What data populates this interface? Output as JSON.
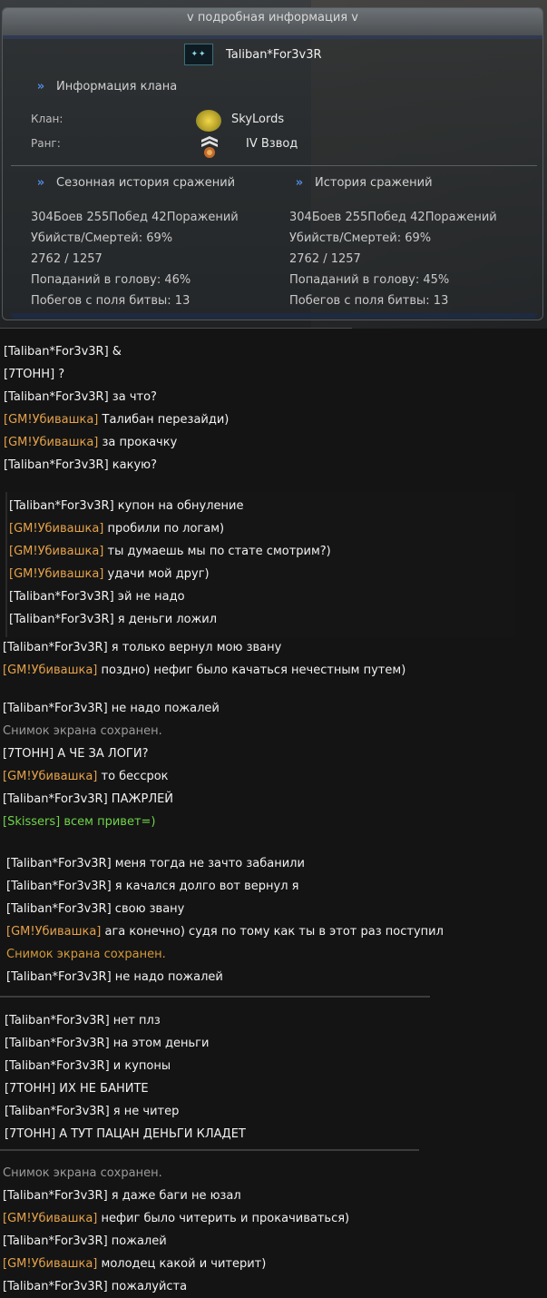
{
  "panel": {
    "title": "v подробная информация v",
    "player_name": "Taliban*For3v3R",
    "player_icon_text": "✦✦",
    "clan_section": "Информация клана",
    "clan_label": "Клан:",
    "clan_value": "SkyLords",
    "rank_label": "Ранг:",
    "rank_value": "IV Взвод",
    "season_section": "Сезонная история сражений",
    "history_section": "История сражений",
    "season_stats": [
      "304Боев 255Побед 42Поражений",
      "Убийств/Смертей: 69%",
      "2762 / 1257",
      "Попаданий в голову: 46%",
      "Побегов с поля битвы: 13"
    ],
    "history_stats": [
      "304Боев 255Побед 42Поражений",
      "Убийств/Смертей: 69%",
      "2762 / 1257",
      "Попаданий в голову: 45%",
      "Побегов с поля битвы: 13"
    ]
  },
  "chat": {
    "block1": [
      {
        "name": "[Taliban*For3v3R]",
        "text": " &"
      },
      {
        "name": "[7ТОНН]",
        "text": " ?"
      },
      {
        "name": "[Taliban*For3v3R]",
        "text": " за что?"
      },
      {
        "name": "[GM!Убивашка]",
        "text": " Талибан перезайди)"
      },
      {
        "name": "[GM!Убивашка]",
        "text": " за прокачку"
      },
      {
        "name": "[Taliban*For3v3R]",
        "text": " какую?"
      }
    ],
    "block2": [
      {
        "name": "[Taliban*For3v3R]",
        "text": " купон на обнуление"
      },
      {
        "name": "[GM!Убивашка]",
        "text": " пробили по логам)"
      },
      {
        "name": "[GM!Убивашка]",
        "text": " ты думаешь мы по стате смотрим?)"
      },
      {
        "name": "[GM!Убивашка]",
        "text": " удачи мой друг)"
      },
      {
        "name": "[Taliban*For3v3R]",
        "text": " эй не надо"
      },
      {
        "name": "[Taliban*For3v3R]",
        "text": " я деньги ложил"
      }
    ],
    "block3": [
      {
        "name": "[Taliban*For3v3R]",
        "text": " я только вернул мою звану"
      },
      {
        "name": "[GM!Убивашка]",
        "text": " поздно) нефиг было качаться нечестным путем)"
      }
    ],
    "block4": [
      {
        "name": "[Taliban*For3v3R]",
        "text": " не надо пожалей"
      },
      {
        "name": "",
        "text": "Снимок экрана сохранен."
      },
      {
        "name": "[7ТОНН]",
        "text": " А ЧЕ ЗА ЛОГИ?"
      },
      {
        "name": "[GM!Убивашка]",
        "text": " то бессрок"
      },
      {
        "name": "[Taliban*For3v3R]",
        "text": " ПАЖРЛЕЙ"
      },
      {
        "name": "[Skissers]",
        "text": " всем привет=)"
      }
    ],
    "block5": [
      {
        "name": "[Taliban*For3v3R]",
        "text": " меня тогда не зачто забанили"
      },
      {
        "name": "[Taliban*For3v3R]",
        "text": " я качался долго вот вернул я"
      },
      {
        "name": "[Taliban*For3v3R]",
        "text": " свою звану"
      },
      {
        "name": "[GM!Убивашка]",
        "text": " ага конечно)  судя по тому как ты в этот раз поступил"
      },
      {
        "name": "",
        "text": "Снимок экрана сохранен."
      },
      {
        "name": "[Taliban*For3v3R]",
        "text": " не надо пожалей"
      }
    ],
    "block6": [
      {
        "name": "[Taliban*For3v3R]",
        "text": " нет плз"
      },
      {
        "name": "[Taliban*For3v3R]",
        "text": " на этом деньги"
      },
      {
        "name": "[Taliban*For3v3R]",
        "text": " и купоны"
      },
      {
        "name": "[7ТОНН]",
        "text": " ИХ НЕ БАНИТЕ"
      },
      {
        "name": "[Taliban*For3v3R]",
        "text": " я не читер"
      },
      {
        "name": "[7ТОНН]",
        "text": " А ТУТ ПАЦАН ДЕНЬГИ КЛАДЕТ"
      }
    ],
    "block7": [
      {
        "name": "",
        "text": "Снимок экрана сохранен."
      },
      {
        "name": "[Taliban*For3v3R]",
        "text": " я даже баги не юзал"
      },
      {
        "name": "[GM!Убивашка]",
        "text": " нефиг было читерить и прокачиваться)"
      },
      {
        "name": "[Taliban*For3v3R]",
        "text": " пожалей"
      },
      {
        "name": "[GM!Убивашка]",
        "text": " молодец какой и читерит)"
      },
      {
        "name": "[Taliban*For3v3R]",
        "text": " пожалуйста"
      }
    ]
  },
  "colors": {
    "gm_name": "#e6a24a",
    "system": "#9a9a9a",
    "system_gold": "#d49a3a",
    "green_chat": "#6fd44a",
    "section_chevron": "#4f8be0"
  }
}
